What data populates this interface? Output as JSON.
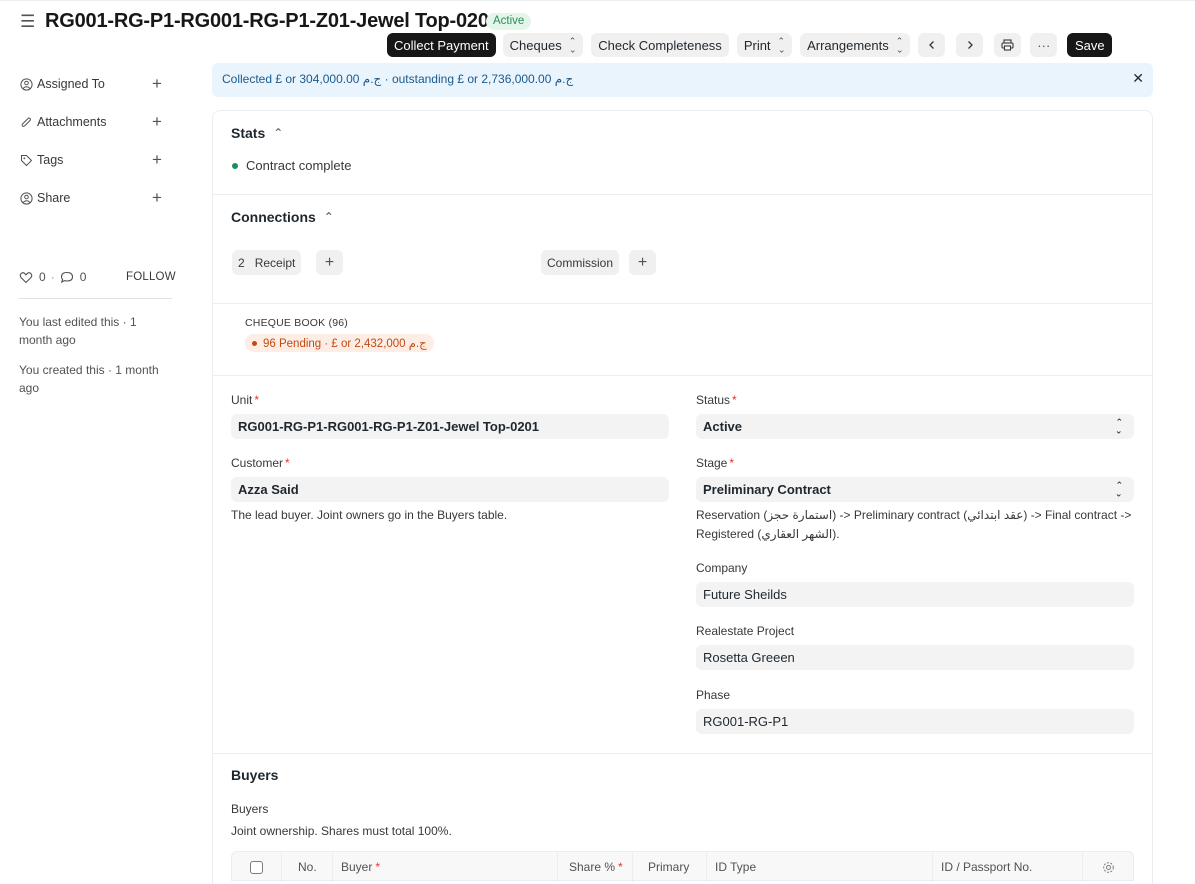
{
  "header": {
    "title": "RG001-RG-P1-RG001-RG-P1-Z01-Jewel Top-0201",
    "status": "Active"
  },
  "toolbar": {
    "collect_payment": "Collect Payment",
    "cheques": "Cheques",
    "check_completeness": "Check Completeness",
    "print": "Print",
    "arrangements": "Arrangements",
    "more": "···",
    "save": "Save"
  },
  "sidebar": {
    "items": [
      {
        "label": "Assigned To",
        "icon": "user-plus-icon"
      },
      {
        "label": "Attachments",
        "icon": "paperclip-icon"
      },
      {
        "label": "Tags",
        "icon": "tag-icon"
      },
      {
        "label": "Share",
        "icon": "user-share-icon"
      }
    ],
    "likes": "0",
    "comments": "0",
    "follow": "FOLLOW",
    "last_edited": "You last edited this · 1 month ago",
    "created": "You created this · 1 month ago"
  },
  "alert": {
    "text": "Collected £ or 304,000.00 ج.م · outstanding £ or 2,736,000.00 ج.م"
  },
  "stats": {
    "heading": "Stats",
    "items": [
      "Contract complete"
    ]
  },
  "connections": {
    "heading": "Connections",
    "receipt_count": "2",
    "receipt_label": "Receipt",
    "commission_label": "Commission",
    "cheque_book_label": "CHEQUE BOOK (96)",
    "cheque_pending": "96 Pending · £ or 2,432,000 ج.م"
  },
  "form": {
    "unit_label": "Unit",
    "unit_value": "RG001-RG-P1-RG001-RG-P1-Z01-Jewel Top-0201",
    "customer_label": "Customer",
    "customer_value": "Azza Said",
    "customer_help": "The lead buyer. Joint owners go in the Buyers table.",
    "status_label": "Status",
    "status_value": "Active",
    "stage_label": "Stage",
    "stage_value": "Preliminary Contract",
    "stage_help": "Reservation (استمارة حجز) -> Preliminary contract (عقد ابتدائي) -> Final contract -> Registered (الشهر العقاري).",
    "company_label": "Company",
    "company_value": "Future Sheilds",
    "project_label": "Realestate Project",
    "project_value": "Rosetta Greeen",
    "phase_label": "Phase",
    "phase_value": "RG001-RG-P1"
  },
  "buyers": {
    "heading": "Buyers",
    "table_label": "Buyers",
    "help": "Joint ownership. Shares must total 100%.",
    "columns": [
      "No.",
      "Buyer",
      "Share %",
      "Primary",
      "ID Type",
      "ID / Passport No."
    ]
  },
  "colors": {
    "accent_dark": "#171717",
    "status_green": "#278f5e",
    "alert_bg": "#eaf4fd",
    "pending_orange": "#c24a15"
  }
}
